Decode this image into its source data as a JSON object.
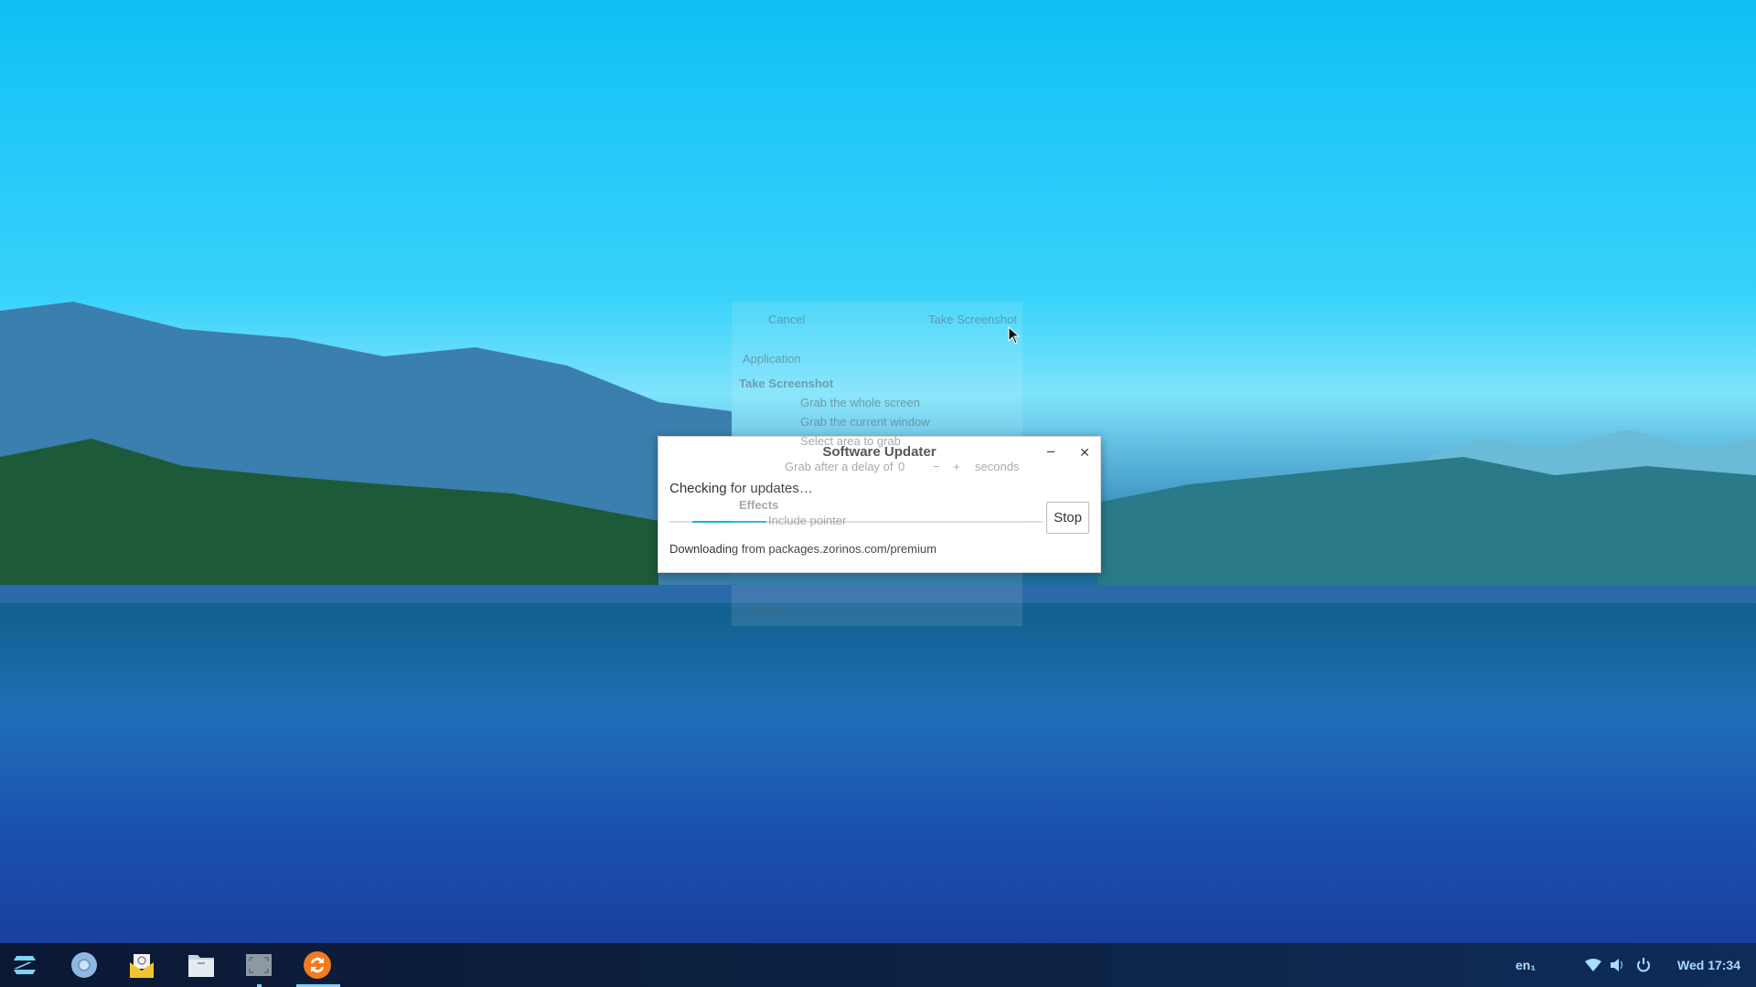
{
  "background_window": {
    "cancel": "Cancel",
    "take_screenshot_button": "Take Screenshot",
    "application": "Application",
    "section_title": "Take Screenshot",
    "option_whole": "Grab the whole screen",
    "option_window": "Grab the current window",
    "option_area": "Select area to grab",
    "delay_label": "Grab after a delay of",
    "delay_value": "0",
    "minus": "−",
    "plus": "+",
    "seconds": "seconds",
    "effects": "Effects",
    "include_pointer": "Include pointer",
    "help": "Help"
  },
  "dialog": {
    "title": "Software Updater",
    "minimize_glyph": "−",
    "close_glyph": "✕",
    "status": "Checking for updates…",
    "progress": {
      "mode": "indeterminate",
      "accent": "#1ab0d8"
    },
    "stop_label": "Stop",
    "source": "Downloading from packages.zorinos.com/premium"
  },
  "taskbar": {
    "apps": [
      {
        "icon": "zorin-menu-icon"
      },
      {
        "icon": "chromium-icon"
      },
      {
        "icon": "mail-icon"
      },
      {
        "icon": "files-icon"
      },
      {
        "icon": "screenshot-icon",
        "running": true
      },
      {
        "icon": "software-updater-icon",
        "active": true
      }
    ],
    "keyboard_layout": "en₁",
    "clock": "Wed 17:34"
  }
}
